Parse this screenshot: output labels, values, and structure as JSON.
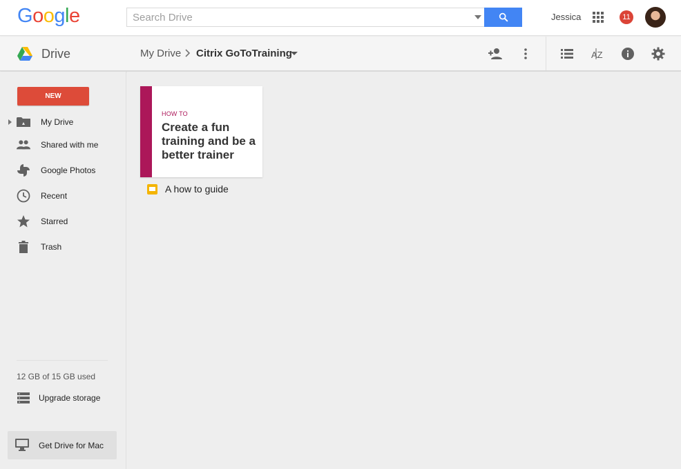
{
  "header": {
    "logo_text": "Google",
    "logo_colors": [
      "#4285f4",
      "#ea4335",
      "#fbbc05",
      "#4285f4",
      "#34a853",
      "#ea4335"
    ],
    "search_placeholder": "Search Drive",
    "user_name": "Jessica",
    "notification_count": "11",
    "search_button_color": "#4285f4"
  },
  "subbar": {
    "app_name": "Drive",
    "breadcrumb": {
      "root": "My Drive",
      "current": "Citrix GoToTraining"
    },
    "icons": [
      "add-person-icon",
      "more-vert-icon",
      "list-view-icon",
      "sort-az-icon",
      "info-icon",
      "settings-icon"
    ]
  },
  "sidebar": {
    "new_label": "NEW",
    "new_color": "#dd4b39",
    "items": [
      {
        "label": "My Drive",
        "icon": "my-drive-icon"
      },
      {
        "label": "Shared with me",
        "icon": "people-icon"
      },
      {
        "label": "Google Photos",
        "icon": "photos-icon"
      },
      {
        "label": "Recent",
        "icon": "clock-icon"
      },
      {
        "label": "Starred",
        "icon": "star-icon"
      },
      {
        "label": "Trash",
        "icon": "trash-icon"
      }
    ],
    "storage_text": "12 GB of 15 GB used",
    "upgrade_label": "Upgrade storage",
    "get_drive_label": "Get Drive for Mac"
  },
  "content": {
    "file": {
      "thumbnail_eyebrow": "HOW TO",
      "thumbnail_title": "Create a fun training and be a better trainer",
      "thumbnail_accent": "#ac1759",
      "name": "A how to guide",
      "type_icon": "slides-icon",
      "type_color": "#f4b400"
    }
  }
}
